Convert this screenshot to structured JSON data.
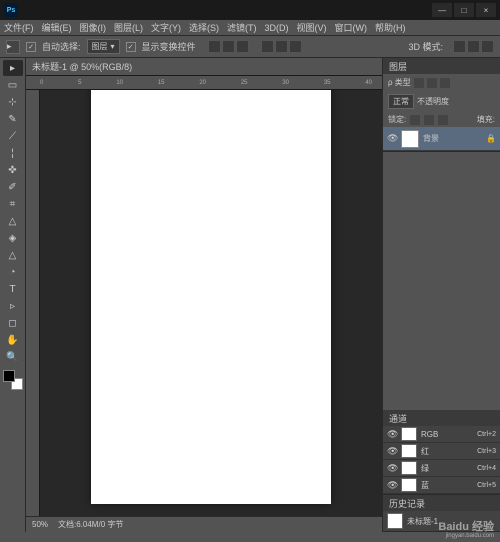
{
  "app": {
    "icon_text": "Ps"
  },
  "window": {
    "min": "—",
    "max": "□",
    "close": "×"
  },
  "menu": [
    "文件(F)",
    "编辑(E)",
    "图像(I)",
    "图层(L)",
    "文字(Y)",
    "选择(S)",
    "滤镜(T)",
    "3D(D)",
    "视图(V)",
    "窗口(W)",
    "帮助(H)"
  ],
  "options": {
    "auto_select": "自动选择:",
    "select_mode": "图层",
    "show_transform": "显示变换控件",
    "mode_3d": "3D 模式:"
  },
  "document": {
    "tab": "未标题-1 @ 50%(RGB/8)",
    "zoom": "50%",
    "doc_info": "文档:6.04M/0 字节"
  },
  "ruler_marks": [
    "0",
    "5",
    "10",
    "15",
    "20",
    "25",
    "30",
    "35",
    "40"
  ],
  "tools": [
    "▸",
    "▭",
    "⊹",
    "✎",
    "⟋",
    "¦",
    "✜",
    "✐",
    "⌗",
    "△",
    "◈",
    "△",
    "◔",
    "T",
    "▹",
    "◻",
    "✋",
    "🔍"
  ],
  "panels": {
    "layers": {
      "tab": "图层",
      "kind": "ρ 类型",
      "blend": "正常",
      "opacity_label": "不透明度",
      "lock_label": "锁定:",
      "fill_label": "填充:",
      "items": [
        {
          "name": "背景"
        }
      ]
    },
    "channels": {
      "tab": "通道",
      "items": [
        {
          "name": "RGB",
          "shortcut": "Ctrl+2"
        },
        {
          "name": "红",
          "shortcut": "Ctrl+3"
        },
        {
          "name": "绿",
          "shortcut": "Ctrl+4"
        },
        {
          "name": "蓝",
          "shortcut": "Ctrl+5"
        }
      ]
    },
    "history": {
      "tab": "历史记录",
      "items": [
        {
          "name": "未标题-1"
        }
      ]
    }
  },
  "watermark": {
    "brand": "Baidu 经验",
    "url": "jingyan.baidu.com"
  }
}
